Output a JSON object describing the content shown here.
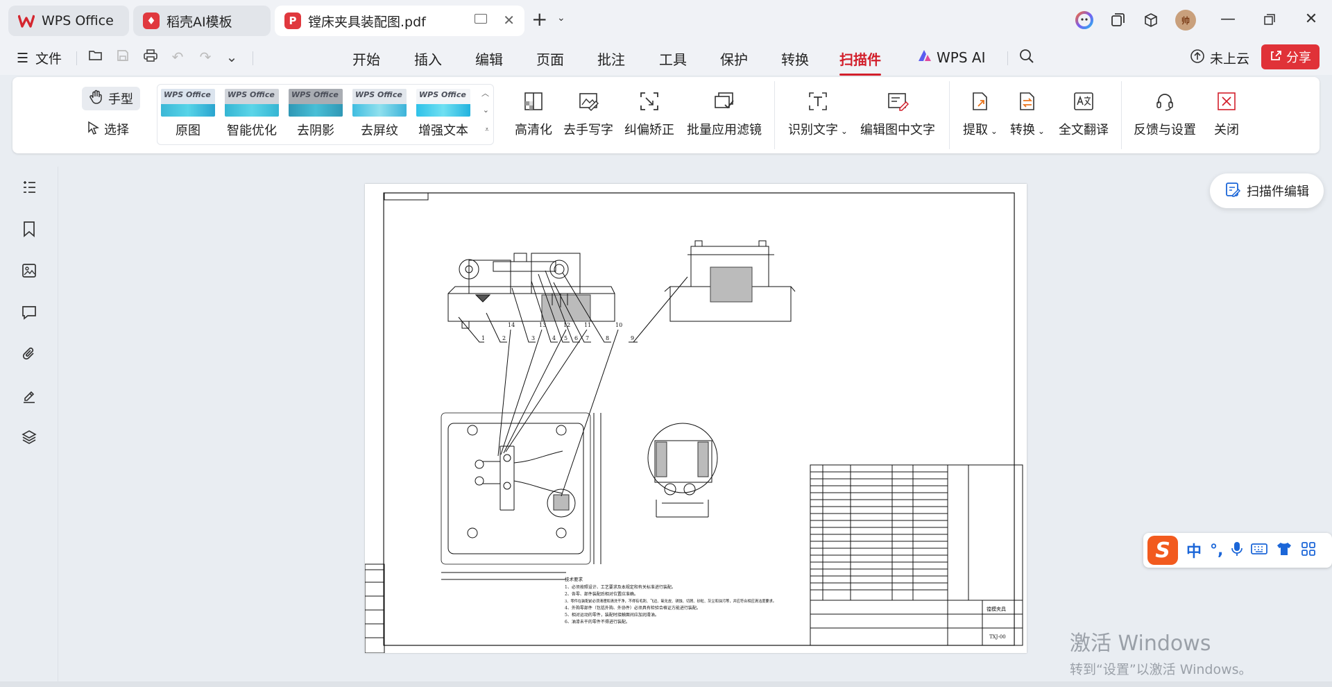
{
  "tabs": [
    {
      "label": "WPS Office",
      "active": false
    },
    {
      "label": "稻壳AI模板",
      "active": false
    },
    {
      "label": "镗床夹具装配图.pdf",
      "active": true
    }
  ],
  "menu": {
    "file": "文件",
    "tabs": [
      "开始",
      "插入",
      "编辑",
      "页面",
      "批注",
      "工具",
      "保护",
      "转换",
      "扫描件"
    ],
    "selected": "扫描件",
    "wps_ai": "WPS AI",
    "cloud": "未上云",
    "share": "分享"
  },
  "ribbon": {
    "hand": "手型",
    "select": "选择",
    "filters": [
      "原图",
      "智能优化",
      "去阴影",
      "去屏纹",
      "增强文本"
    ],
    "filter_brand": "WPS Office",
    "tools": [
      "高清化",
      "去手写字",
      "纠偏矫正",
      "批量应用滤镜",
      "识别文字",
      "编辑图中文字",
      "提取",
      "转换",
      "全文翻译",
      "反馈与设置",
      "关闭"
    ]
  },
  "avatar_text": "帅",
  "float_button": "扫描件编辑",
  "ime": {
    "items": [
      "中",
      "°,"
    ]
  },
  "watermark": {
    "line1": "激活 Windows",
    "line2": "转到“设置”以激活 Windows。"
  },
  "drawing": {
    "balloons_top": [
      "1",
      "2",
      "3",
      "4",
      "5",
      "6",
      "7",
      "8",
      "9"
    ],
    "balloons_mid": [
      "14",
      "13",
      "12",
      "11",
      "10"
    ],
    "title_block": {
      "name": "镗模夹具",
      "code": "TXJ-00"
    },
    "notes_title": "技术要求",
    "notes": [
      "1、必须按照设计、工艺要求及本规定和有关标准进行装配。",
      "2、各零、部件装配后相对位置应准确。",
      "3、零件在装配前必须清理和清洗干净，不得有毛刺、飞边、氧化皮、锈蚀、切屑、砂粒、灰尘和油污等，并应符合相应清洁度要求。",
      "4、外购零部件（包括外购、外协件）必须具有检验合格证方能进行装配。",
      "5、相对运动的零件，装配时接触面间应加润滑油。",
      "6、油漆未干的零件不得进行装配。"
    ]
  },
  "colors": {
    "accent": "#d21f2b",
    "share_bg": "#e03238",
    "ime_orange": "#f25a1e"
  }
}
